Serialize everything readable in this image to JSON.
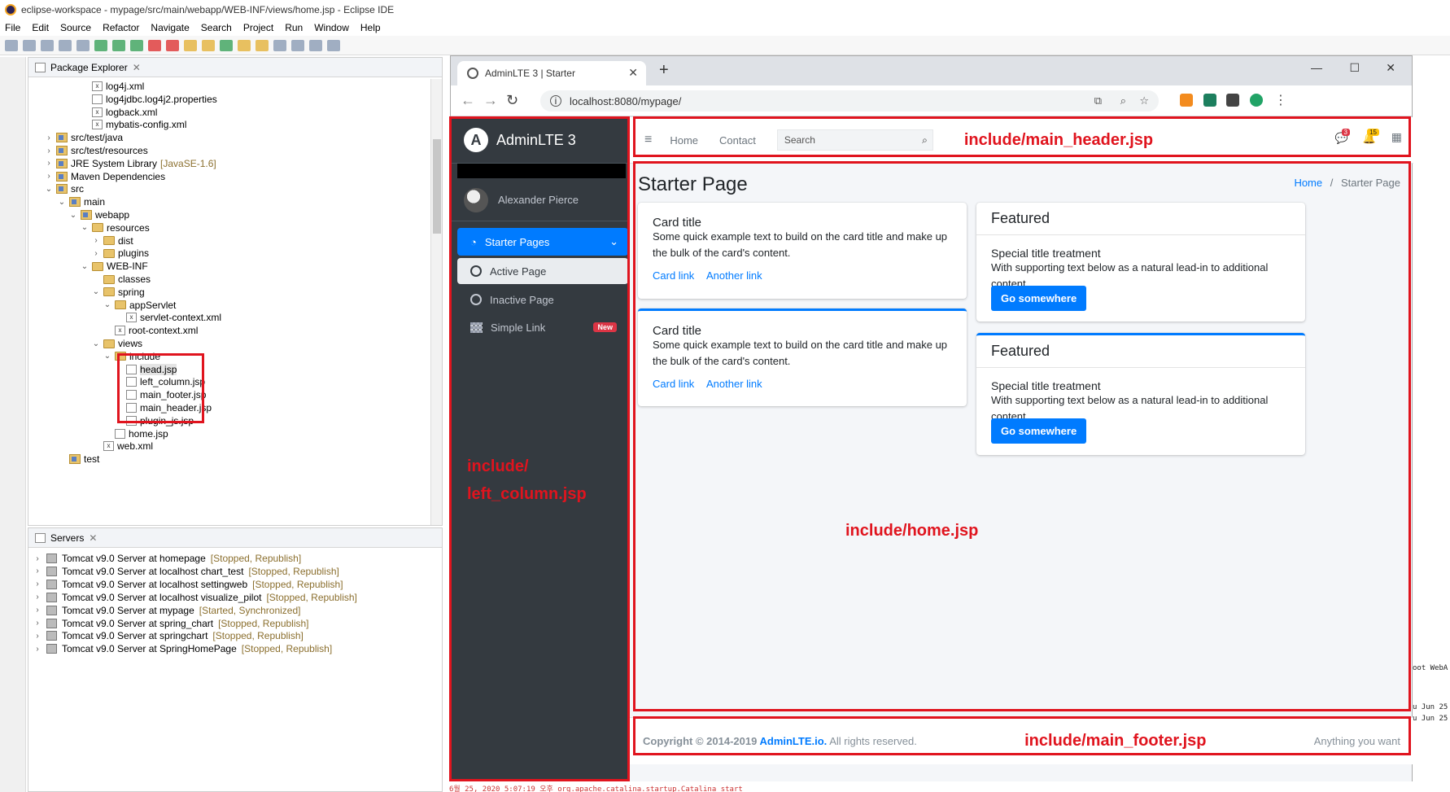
{
  "window_title": "eclipse-workspace - mypage/src/main/webapp/WEB-INF/views/home.jsp - Eclipse IDE",
  "menu": [
    "File",
    "Edit",
    "Source",
    "Refactor",
    "Navigate",
    "Search",
    "Project",
    "Run",
    "Window",
    "Help"
  ],
  "package_explorer": {
    "title": "Package Explorer",
    "tree": [
      {
        "label": "log4j.xml",
        "depth": 4,
        "kind": "xml"
      },
      {
        "label": "log4jdbc.log4j2.properties",
        "depth": 4,
        "kind": "file"
      },
      {
        "label": "logback.xml",
        "depth": 4,
        "kind": "xml"
      },
      {
        "label": "mybatis-config.xml",
        "depth": 4,
        "kind": "xml"
      },
      {
        "label": "src/test/java",
        "depth": 1,
        "kind": "pkg",
        "chev": ">"
      },
      {
        "label": "src/test/resources",
        "depth": 1,
        "kind": "pkg",
        "chev": ">"
      },
      {
        "label": "JRE System Library",
        "extra": "[JavaSE-1.6]",
        "depth": 1,
        "kind": "lib",
        "chev": ">"
      },
      {
        "label": "Maven Dependencies",
        "depth": 1,
        "kind": "lib",
        "chev": ">"
      },
      {
        "label": "src",
        "depth": 1,
        "kind": "pkg",
        "chev": "v"
      },
      {
        "label": "main",
        "depth": 2,
        "kind": "pkg",
        "chev": "v"
      },
      {
        "label": "webapp",
        "depth": 3,
        "kind": "pkg",
        "chev": "v"
      },
      {
        "label": "resources",
        "depth": 4,
        "kind": "folder",
        "chev": "v"
      },
      {
        "label": "dist",
        "depth": 5,
        "kind": "folder",
        "chev": ">"
      },
      {
        "label": "plugins",
        "depth": 5,
        "kind": "folder",
        "chev": ">"
      },
      {
        "label": "WEB-INF",
        "depth": 4,
        "kind": "folder",
        "chev": "v"
      },
      {
        "label": "classes",
        "depth": 5,
        "kind": "folder"
      },
      {
        "label": "spring",
        "depth": 5,
        "kind": "folder",
        "chev": "v"
      },
      {
        "label": "appServlet",
        "depth": 6,
        "kind": "folder",
        "chev": "v"
      },
      {
        "label": "servlet-context.xml",
        "depth": 7,
        "kind": "xml"
      },
      {
        "label": "root-context.xml",
        "depth": 6,
        "kind": "xml"
      },
      {
        "label": "views",
        "depth": 5,
        "kind": "folder",
        "chev": "v"
      },
      {
        "label": "include",
        "depth": 6,
        "kind": "folder",
        "chev": "v"
      },
      {
        "label": "head.jsp",
        "depth": 7,
        "kind": "file"
      },
      {
        "label": "left_column.jsp",
        "depth": 7,
        "kind": "file"
      },
      {
        "label": "main_footer.jsp",
        "depth": 7,
        "kind": "file"
      },
      {
        "label": "main_header.jsp",
        "depth": 7,
        "kind": "file"
      },
      {
        "label": "plugin_js.jsp",
        "depth": 7,
        "kind": "file"
      },
      {
        "label": "home.jsp",
        "depth": 6,
        "kind": "file"
      },
      {
        "label": "web.xml",
        "depth": 5,
        "kind": "xml"
      },
      {
        "label": "test",
        "depth": 2,
        "kind": "pkg"
      }
    ]
  },
  "servers": {
    "title": "Servers",
    "items": [
      {
        "name": "Tomcat v9.0 Server at homepage",
        "status": "[Stopped, Republish]"
      },
      {
        "name": "Tomcat v9.0 Server at localhost chart_test",
        "status": "[Stopped, Republish]"
      },
      {
        "name": "Tomcat v9.0 Server at localhost settingweb",
        "status": "[Stopped, Republish]"
      },
      {
        "name": "Tomcat v9.0 Server at localhost visualize_pilot",
        "status": "[Stopped, Republish]"
      },
      {
        "name": "Tomcat v9.0 Server at mypage",
        "status": "[Started, Synchronized]"
      },
      {
        "name": "Tomcat v9.0 Server at spring_chart",
        "status": "[Stopped, Republish]"
      },
      {
        "name": "Tomcat v9.0 Server at springchart",
        "status": "[Stopped, Republish]"
      },
      {
        "name": "Tomcat v9.0 Server at SpringHomePage",
        "status": "[Stopped, Republish]"
      }
    ]
  },
  "console": {
    "right_lines": [
      "oot WebA",
      "u Jun 25",
      "u Jun 25"
    ],
    "bottom_line": "6월 25, 2020 5:07:19 오후 org.apache.catalina.startup.Catalina start"
  },
  "browser": {
    "tab_title": "AdminLTE 3 | Starter",
    "url": "localhost:8080/mypage/",
    "win_controls": [
      "—",
      "☐",
      "✕"
    ]
  },
  "adminlte": {
    "brand": "AdminLTE 3",
    "brand_letter": "A",
    "user": "Alexander Pierce",
    "nav": {
      "starter": "Starter Pages",
      "active": "Active Page",
      "inactive": "Inactive Page",
      "simple": "Simple Link",
      "new_badge": "New"
    },
    "header": {
      "home": "Home",
      "contact": "Contact",
      "search_placeholder": "Search",
      "msg_count": "3",
      "notif_count": "15"
    },
    "page_title": "Starter Page",
    "breadcrumb": {
      "home": "Home",
      "sep": "/",
      "current": "Starter Page"
    },
    "cards_left": [
      {
        "title": "Card title",
        "text": "Some quick example text to build on the card title and make up the bulk of the card's content.",
        "link1": "Card link",
        "link2": "Another link"
      },
      {
        "title": "Card title",
        "text": "Some quick example text to build on the card title and make up the bulk of the card's content.",
        "link1": "Card link",
        "link2": "Another link"
      }
    ],
    "cards_right": [
      {
        "header": "Featured",
        "title": "Special title treatment",
        "text": "With supporting text below as a natural lead-in to additional content.",
        "button": "Go somewhere"
      },
      {
        "header": "Featured",
        "title": "Special title treatment",
        "text": "With supporting text below as a natural lead-in to additional content.",
        "button": "Go somewhere"
      }
    ],
    "footer": {
      "copy": "Copyright © 2014-2019 ",
      "link": "AdminLTE.io.",
      "rest": " All rights reserved.",
      "right": "Anything you want"
    }
  },
  "annotations": {
    "header": "include/main_header.jsp",
    "left1": "include/",
    "left2": "left_column.jsp",
    "home": "include/home.jsp",
    "footer": "include/main_footer.jsp"
  },
  "colors": {
    "annotation_red": "#e0141e",
    "primary": "#007bff",
    "sidebar": "#343a40"
  }
}
